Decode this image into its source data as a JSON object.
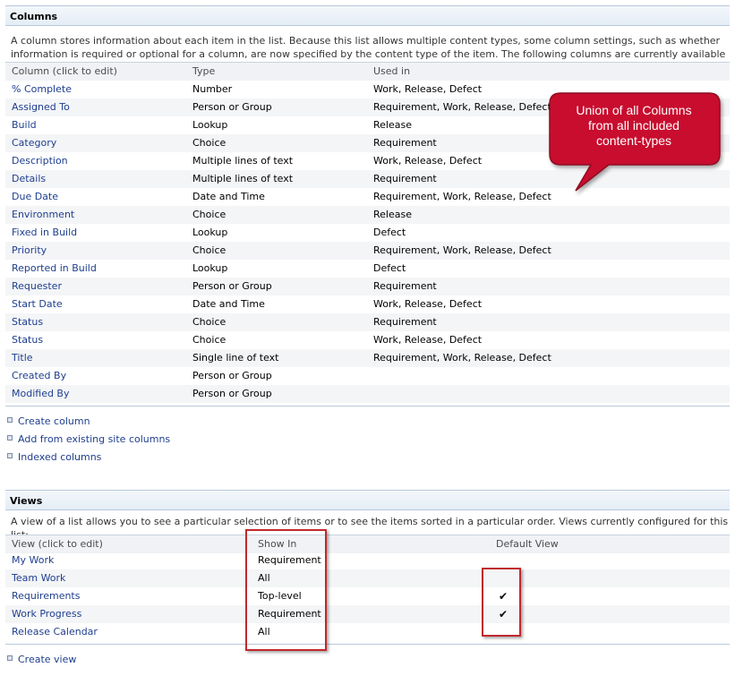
{
  "columns_section": {
    "title": "Columns",
    "description": "A column stores information about each item in the list. Because this list allows multiple content types, some column settings, such as whether information is required or optional for a column, are now specified by the content type of the item. The following columns are currently available in this list:",
    "headers": [
      "Column (click to edit)",
      "Type",
      "Used in"
    ],
    "rows": [
      {
        "name": "% Complete",
        "type": "Number",
        "used_in": "Work, Release, Defect"
      },
      {
        "name": "Assigned To",
        "type": "Person or Group",
        "used_in": "Requirement, Work, Release, Defect"
      },
      {
        "name": "Build",
        "type": "Lookup",
        "used_in": "Release"
      },
      {
        "name": "Category",
        "type": "Choice",
        "used_in": "Requirement"
      },
      {
        "name": "Description",
        "type": "Multiple lines of text",
        "used_in": "Work, Release, Defect"
      },
      {
        "name": "Details",
        "type": "Multiple lines of text",
        "used_in": "Requirement"
      },
      {
        "name": "Due Date",
        "type": "Date and Time",
        "used_in": "Requirement, Work, Release, Defect"
      },
      {
        "name": "Environment",
        "type": "Choice",
        "used_in": "Release"
      },
      {
        "name": "Fixed in Build",
        "type": "Lookup",
        "used_in": "Defect"
      },
      {
        "name": "Priority",
        "type": "Choice",
        "used_in": "Requirement, Work, Release, Defect"
      },
      {
        "name": "Reported in Build",
        "type": "Lookup",
        "used_in": "Defect"
      },
      {
        "name": "Requester",
        "type": "Person or Group",
        "used_in": "Requirement"
      },
      {
        "name": "Start Date",
        "type": "Date and Time",
        "used_in": "Work, Release, Defect"
      },
      {
        "name": "Status",
        "type": "Choice",
        "used_in": "Requirement"
      },
      {
        "name": "Status",
        "type": "Choice",
        "used_in": "Work, Release, Defect"
      },
      {
        "name": "Title",
        "type": "Single line of text",
        "used_in": "Requirement, Work, Release, Defect"
      },
      {
        "name": "Created By",
        "type": "Person or Group",
        "used_in": ""
      },
      {
        "name": "Modified By",
        "type": "Person or Group",
        "used_in": ""
      }
    ],
    "actions": [
      "Create column",
      "Add from existing site columns",
      "Indexed columns"
    ]
  },
  "callout": {
    "line1": "Union of all Columns",
    "line2": "from all included",
    "line3": "content-types",
    "fill_color": "#c8102e"
  },
  "views_section": {
    "title": "Views",
    "description": "A view of a list allows you to see a particular selection of items or to see the items sorted in a particular order. Views currently configured for this list:",
    "headers": [
      "View (click to edit)",
      "Show In",
      "Default View"
    ],
    "rows": [
      {
        "name": "My Work",
        "show_in": "Requirement",
        "default": false
      },
      {
        "name": "Team Work",
        "show_in": "All",
        "default": false
      },
      {
        "name": "Requirements",
        "show_in": "Top-level",
        "default": true
      },
      {
        "name": "Work Progress",
        "show_in": "Requirement",
        "default": true
      },
      {
        "name": "Release Calendar",
        "show_in": "All",
        "default": false
      }
    ],
    "actions": [
      "Create view"
    ],
    "check_glyph": "✔"
  }
}
